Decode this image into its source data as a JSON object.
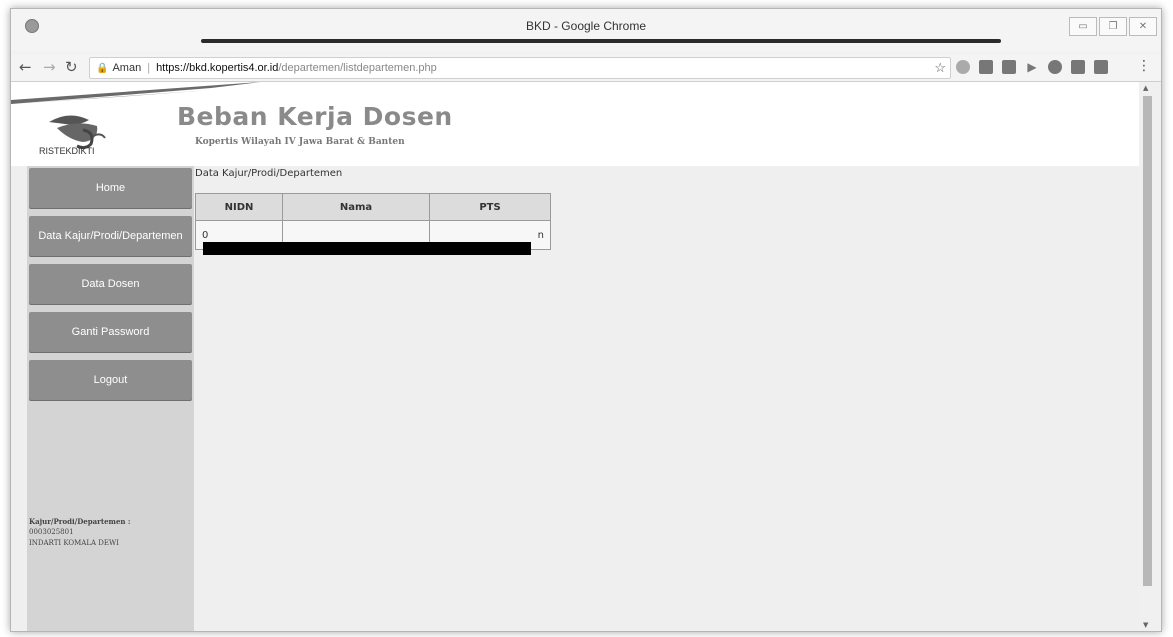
{
  "window": {
    "title": "BKD - Google Chrome"
  },
  "browser": {
    "secure_label": "Aman",
    "url_host": "https://bkd.kopertis4.or.id",
    "url_path": "/departemen/listdepartemen.php"
  },
  "header": {
    "logo_text": "RISTEKDIKTI",
    "title": "Beban Kerja Dosen",
    "subtitle": "Kopertis Wilayah IV Jawa Barat & Banten"
  },
  "sidebar": {
    "items": [
      {
        "label": "Home"
      },
      {
        "label": "Data Kajur/Prodi/Departemen"
      },
      {
        "label": "Data Dosen"
      },
      {
        "label": "Ganti Password"
      },
      {
        "label": "Logout"
      }
    ],
    "user_label": "Kajur/Prodi/Departemen :",
    "user_id": "0003025801",
    "user_name": "INDARTI KOMALA DEWI"
  },
  "content": {
    "heading": "Data Kajur/Prodi/Departemen",
    "table": {
      "columns": [
        "NIDN",
        "Nama",
        "PTS"
      ],
      "rows": [
        {
          "nidn": "0",
          "nama": "",
          "pts": "n"
        }
      ]
    }
  }
}
